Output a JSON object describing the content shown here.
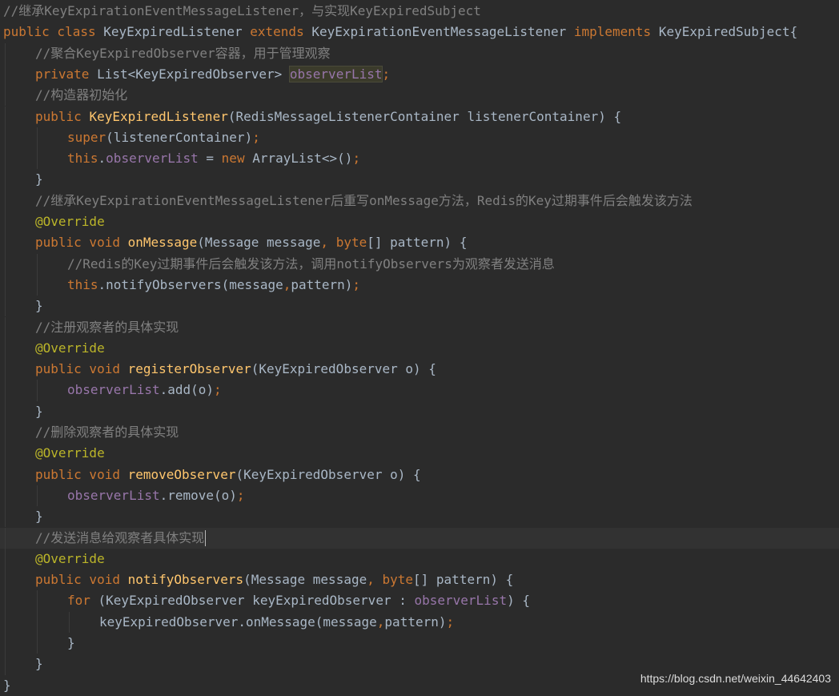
{
  "colors": {
    "background": "#2b2b2b",
    "current_line": "#323232",
    "keyword": "#cc7832",
    "method": "#ffc66d",
    "field": "#9876aa",
    "annotation": "#bbb529",
    "comment": "#808080",
    "plain": "#a9b7c6"
  },
  "editor": {
    "lines": [
      {
        "indent": 0,
        "tokens": [
          {
            "t": "//继承KeyExpirationEventMessageListener，与实现KeyExpiredSubject",
            "c": "comment"
          }
        ]
      },
      {
        "indent": 0,
        "tokens": [
          {
            "t": "public class ",
            "c": "keyword"
          },
          {
            "t": "KeyExpiredListener ",
            "c": "plain"
          },
          {
            "t": "extends ",
            "c": "keyword"
          },
          {
            "t": "KeyExpirationEventMessageListener ",
            "c": "plain"
          },
          {
            "t": "implements ",
            "c": "keyword"
          },
          {
            "t": "KeyExpiredSubject{",
            "c": "plain"
          }
        ]
      },
      {
        "indent": 1,
        "tokens": [
          {
            "t": "//聚合KeyExpiredObserver容器，用于管理观察",
            "c": "comment"
          }
        ]
      },
      {
        "indent": 1,
        "tokens": [
          {
            "t": "private ",
            "c": "keyword"
          },
          {
            "t": "List<KeyExpiredObserver> ",
            "c": "plain"
          },
          {
            "t": "observerList",
            "c": "field-hl"
          },
          {
            "t": ";",
            "c": "punct"
          }
        ]
      },
      {
        "indent": 1,
        "tokens": [
          {
            "t": "//构造器初始化",
            "c": "comment"
          }
        ]
      },
      {
        "indent": 1,
        "tokens": [
          {
            "t": "public ",
            "c": "keyword"
          },
          {
            "t": "KeyExpiredListener",
            "c": "method"
          },
          {
            "t": "(RedisMessageListenerContainer listenerContainer) {",
            "c": "plain"
          }
        ]
      },
      {
        "indent": 2,
        "tokens": [
          {
            "t": "super",
            "c": "keyword"
          },
          {
            "t": "(listenerContainer)",
            "c": "plain"
          },
          {
            "t": ";",
            "c": "punct"
          }
        ]
      },
      {
        "indent": 2,
        "tokens": [
          {
            "t": "this",
            "c": "keyword"
          },
          {
            "t": ".",
            "c": "plain"
          },
          {
            "t": "observerList",
            "c": "field"
          },
          {
            "t": " = ",
            "c": "plain"
          },
          {
            "t": "new ",
            "c": "keyword"
          },
          {
            "t": "ArrayList<>()",
            "c": "plain"
          },
          {
            "t": ";",
            "c": "punct"
          }
        ]
      },
      {
        "indent": 1,
        "tokens": [
          {
            "t": "}",
            "c": "plain"
          }
        ]
      },
      {
        "indent": 1,
        "tokens": [
          {
            "t": "//继承KeyExpirationEventMessageListener后重写onMessage方法，Redis的Key过期事件后会触发该方法",
            "c": "comment"
          }
        ]
      },
      {
        "indent": 1,
        "tokens": [
          {
            "t": "@Override",
            "c": "annotation"
          }
        ]
      },
      {
        "indent": 1,
        "tokens": [
          {
            "t": "public void ",
            "c": "keyword"
          },
          {
            "t": "onMessage",
            "c": "method"
          },
          {
            "t": "(Message message",
            "c": "plain"
          },
          {
            "t": ", ",
            "c": "punct"
          },
          {
            "t": "byte",
            "c": "keyword"
          },
          {
            "t": "[] pattern) {",
            "c": "plain"
          }
        ]
      },
      {
        "indent": 2,
        "tokens": [
          {
            "t": "//Redis的Key过期事件后会触发该方法，调用notifyObservers为观察者发送消息",
            "c": "comment"
          }
        ]
      },
      {
        "indent": 2,
        "tokens": [
          {
            "t": "this",
            "c": "keyword"
          },
          {
            "t": ".notifyObservers(message",
            "c": "plain"
          },
          {
            "t": ",",
            "c": "punct"
          },
          {
            "t": "pattern)",
            "c": "plain"
          },
          {
            "t": ";",
            "c": "punct"
          }
        ]
      },
      {
        "indent": 1,
        "tokens": [
          {
            "t": "}",
            "c": "plain"
          }
        ]
      },
      {
        "indent": 1,
        "tokens": [
          {
            "t": "//注册观察者的具体实现",
            "c": "comment"
          }
        ]
      },
      {
        "indent": 1,
        "tokens": [
          {
            "t": "@Override",
            "c": "annotation"
          }
        ]
      },
      {
        "indent": 1,
        "tokens": [
          {
            "t": "public void ",
            "c": "keyword"
          },
          {
            "t": "registerObserver",
            "c": "method"
          },
          {
            "t": "(KeyExpiredObserver o) {",
            "c": "plain"
          }
        ]
      },
      {
        "indent": 2,
        "tokens": [
          {
            "t": "observerList",
            "c": "field"
          },
          {
            "t": ".add(o)",
            "c": "plain"
          },
          {
            "t": ";",
            "c": "punct"
          }
        ]
      },
      {
        "indent": 1,
        "tokens": [
          {
            "t": "}",
            "c": "plain"
          }
        ]
      },
      {
        "indent": 1,
        "tokens": [
          {
            "t": "//删除观察者的具体实现",
            "c": "comment"
          }
        ]
      },
      {
        "indent": 1,
        "tokens": [
          {
            "t": "@Override",
            "c": "annotation"
          }
        ]
      },
      {
        "indent": 1,
        "tokens": [
          {
            "t": "public void ",
            "c": "keyword"
          },
          {
            "t": "removeObserver",
            "c": "method"
          },
          {
            "t": "(KeyExpiredObserver o) {",
            "c": "plain"
          }
        ]
      },
      {
        "indent": 2,
        "tokens": [
          {
            "t": "observerList",
            "c": "field"
          },
          {
            "t": ".remove(o)",
            "c": "plain"
          },
          {
            "t": ";",
            "c": "punct"
          }
        ]
      },
      {
        "indent": 1,
        "tokens": [
          {
            "t": "}",
            "c": "plain"
          }
        ]
      },
      {
        "indent": 1,
        "current": true,
        "tokens": [
          {
            "t": "//发送消息给观察者具体实现",
            "c": "comment"
          }
        ]
      },
      {
        "indent": 1,
        "tokens": [
          {
            "t": "@Override",
            "c": "annotation"
          }
        ]
      },
      {
        "indent": 1,
        "tokens": [
          {
            "t": "public void ",
            "c": "keyword"
          },
          {
            "t": "notifyObservers",
            "c": "method"
          },
          {
            "t": "(Message message",
            "c": "plain"
          },
          {
            "t": ", ",
            "c": "punct"
          },
          {
            "t": "byte",
            "c": "keyword"
          },
          {
            "t": "[] pattern) {",
            "c": "plain"
          }
        ]
      },
      {
        "indent": 2,
        "tokens": [
          {
            "t": "for ",
            "c": "keyword"
          },
          {
            "t": "(KeyExpiredObserver keyExpiredObserver : ",
            "c": "plain"
          },
          {
            "t": "observerList",
            "c": "field"
          },
          {
            "t": ") {",
            "c": "plain"
          }
        ]
      },
      {
        "indent": 3,
        "tokens": [
          {
            "t": "keyExpiredObserver.onMessage(message",
            "c": "plain"
          },
          {
            "t": ",",
            "c": "punct"
          },
          {
            "t": "pattern)",
            "c": "plain"
          },
          {
            "t": ";",
            "c": "punct"
          }
        ]
      },
      {
        "indent": 2,
        "tokens": [
          {
            "t": "}",
            "c": "plain"
          }
        ]
      },
      {
        "indent": 1,
        "tokens": [
          {
            "t": "}",
            "c": "plain"
          }
        ]
      },
      {
        "indent": 0,
        "tokens": [
          {
            "t": "}",
            "c": "plain"
          }
        ]
      }
    ]
  },
  "watermark": "https://blog.csdn.net/weixin_44642403"
}
